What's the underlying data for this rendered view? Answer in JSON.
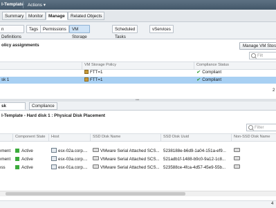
{
  "titlebar": {
    "title": "l-Template",
    "actions": "Actions ▾"
  },
  "top_tabs": [
    "Summary",
    "Monitor",
    "Manage",
    "Related Objects"
  ],
  "sub_tabs": [
    "n Definitions",
    "Tags",
    "Permissions",
    "VM Storage Policies",
    "Scheduled Tasks",
    "vServices"
  ],
  "upper": {
    "title": "olicy assignments",
    "manage_button": "Manage VM Storag",
    "filter_placeholder": "Filt",
    "columns": [
      "VM Storage Policy",
      "Compliance Status"
    ],
    "rows": [
      {
        "name": "",
        "policy": "FTT=1",
        "status": "Compliant"
      },
      {
        "name": "sk 1",
        "policy": "FTT=1",
        "status": "Compliant"
      }
    ],
    "footer_count": "2"
  },
  "bottom_tabs": [
    "sk Placement",
    "Compliance Failures"
  ],
  "lower": {
    "title": "l-Template - Hard disk 1 : Physical Disk Placement",
    "filter_placeholder": "Filter",
    "columns": [
      "Component State",
      "Host",
      "SSD Disk Name",
      "SSD Disk Uuid",
      "Non-SSD Disk Name"
    ],
    "rows": [
      {
        "type": "ement",
        "state": "Active",
        "host": "esx-02a.corp....",
        "ssd_name": "VMware Serial Attached SCS...",
        "ssd_uuid": "5238188e-b6d9-1a04-151a-ef9..."
      },
      {
        "type": "ement",
        "state": "Active",
        "host": "esx-03a.corp....",
        "ssd_name": "VMware Serial Attached SCS...",
        "ssd_uuid": "521adb1f-1488-b9c0-9a12-1c8..."
      },
      {
        "type": "ess",
        "state": "Active",
        "host": "esx-01a.corp....",
        "ssd_name": "VMware Serial Attached SCS...",
        "ssd_uuid": "523588ce-4fca-4d57-45e9-55b..."
      }
    ],
    "footer_count": "4"
  }
}
